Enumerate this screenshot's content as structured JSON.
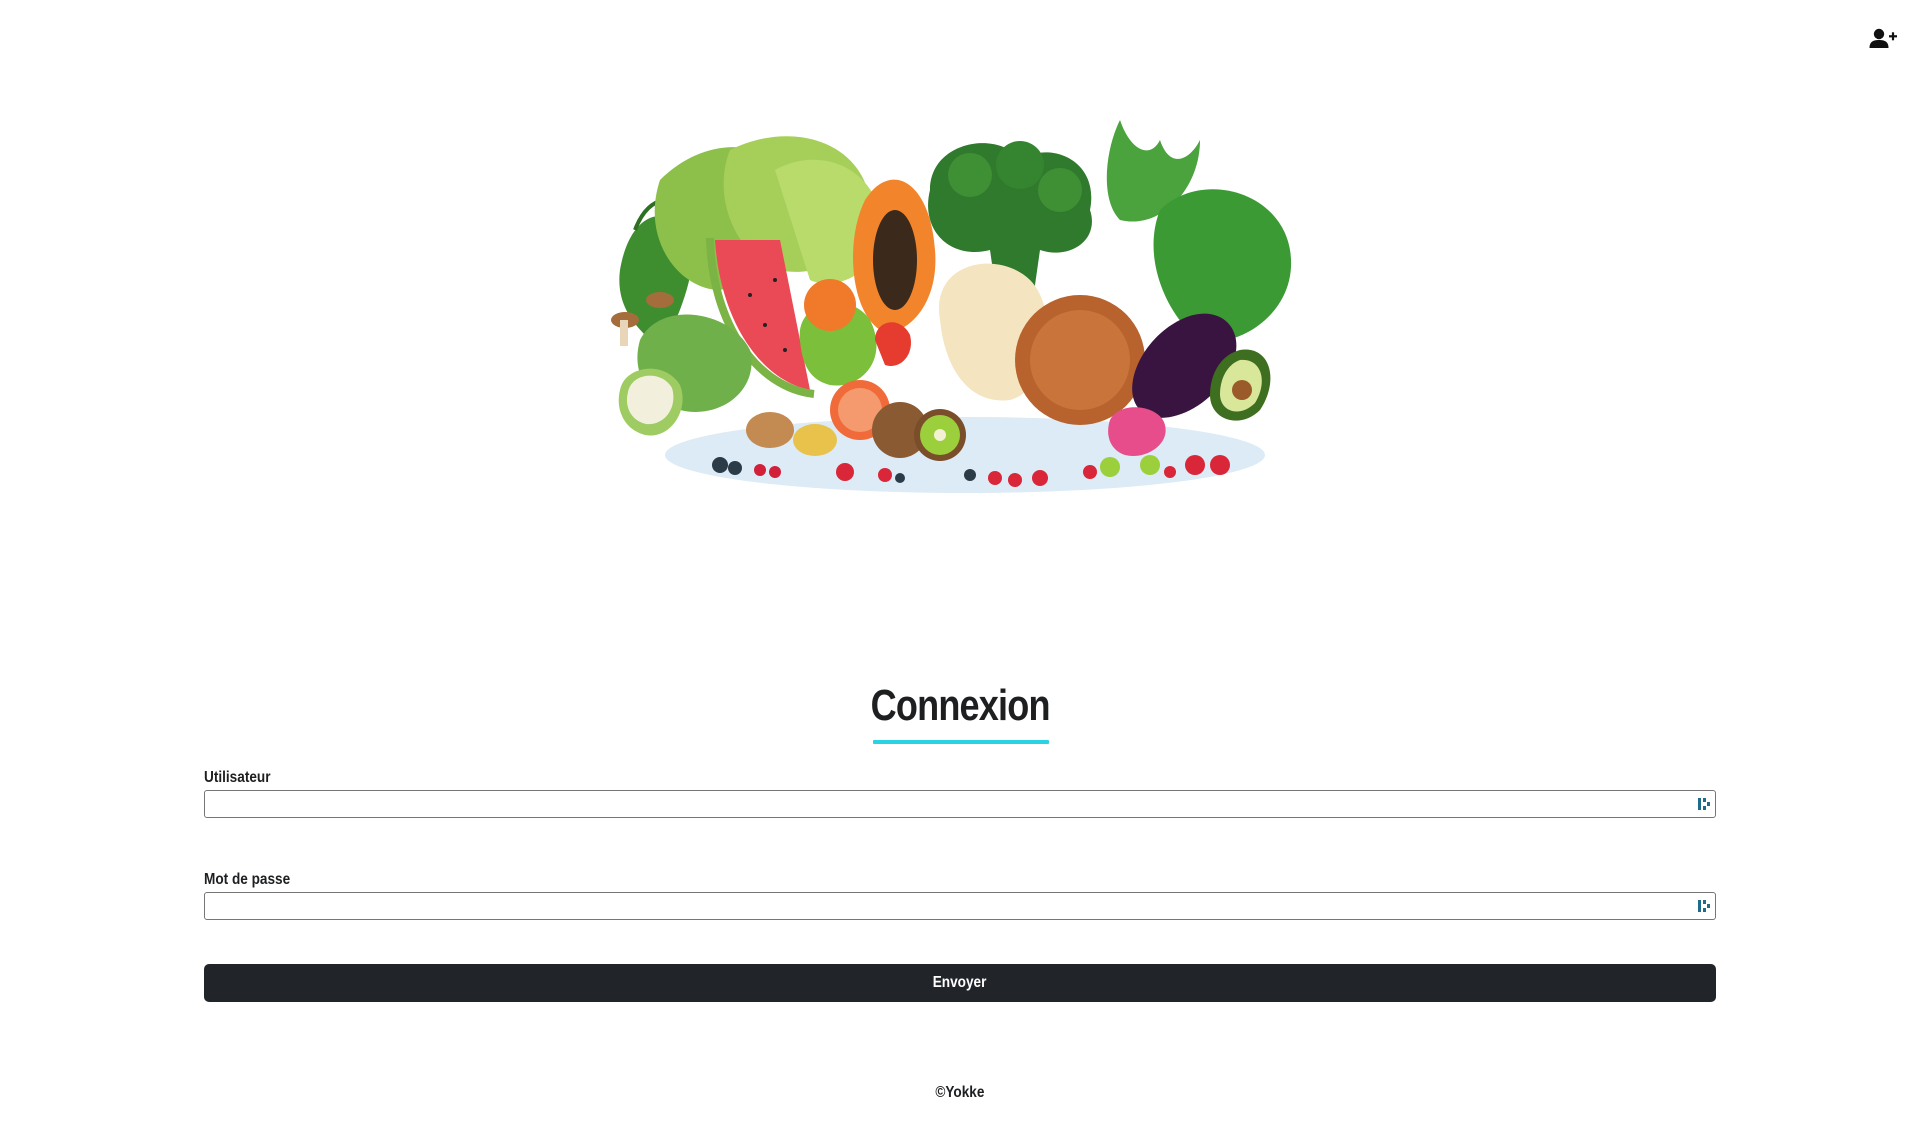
{
  "header": {
    "register_icon": "add-user-icon"
  },
  "hero": {
    "image": "fruits-vegetables-illustration"
  },
  "login": {
    "title": "Connexion",
    "accent_color": "#29d3e3",
    "username_label": "Utilisateur",
    "username_value": "",
    "password_label": "Mot de passe",
    "password_value": "",
    "submit_label": "Envoyer"
  },
  "footer": {
    "copyright": "©Yokke"
  }
}
